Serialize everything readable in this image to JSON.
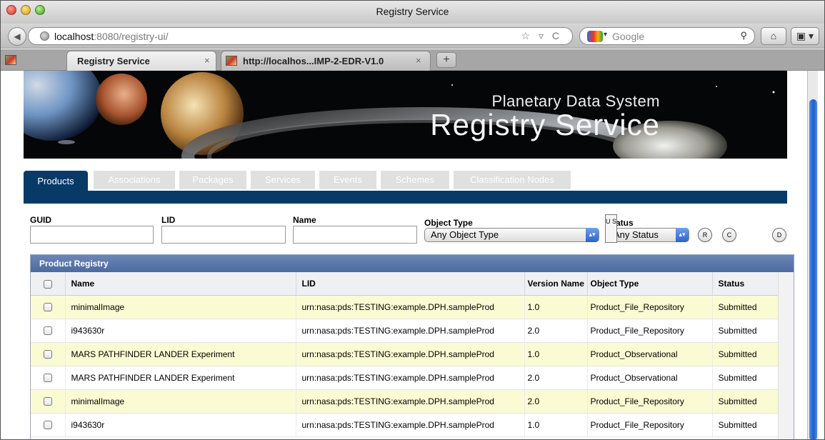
{
  "window": {
    "title": "Registry Service"
  },
  "navbar": {
    "back_icon": "back-arrow-icon",
    "url_host": "localhost",
    "url_rest": ":8080/registry-ui/",
    "url_icons": "☆ ▿ C",
    "search_placeholder": "Google",
    "home_icon": "⌂",
    "bookmark_icon": "▣"
  },
  "browser_tabs": [
    {
      "label": "Registry Service",
      "close": "×"
    },
    {
      "label": "http://localhos...IMP-2-EDR-V1.0",
      "close": "×"
    }
  ],
  "browser_tab_add": "+",
  "banner": {
    "line1": "Planetary Data System",
    "line2": "Registry Service"
  },
  "app_tabs": [
    "Products",
    "Associations",
    "Packages",
    "Services",
    "Events",
    "Schemes",
    "Classification Nodes"
  ],
  "filters": {
    "guid_label": "GUID",
    "lid_label": "LID",
    "name_label": "Name",
    "object_type_label": "Object Type",
    "object_type_value": "Any Object Type",
    "status_label": "Status",
    "status_value": "Any Status",
    "btn_r": "R",
    "btn_c": "C",
    "btn_us": "U S",
    "btn_d": "D"
  },
  "grid": {
    "title": "Product Registry",
    "columns": [
      "",
      "Name",
      "LID",
      "Version Name",
      "Object Type",
      "Status"
    ],
    "rows": [
      {
        "name": "minimalImage",
        "lid": "urn:nasa:pds:TESTING:example.DPH.sampleProd",
        "version": "1.0",
        "object_type": "Product_File_Repository",
        "status": "Submitted",
        "highlight": true
      },
      {
        "name": "i943630r",
        "lid": "urn:nasa:pds:TESTING:example.DPH.sampleProd",
        "version": "2.0",
        "object_type": "Product_File_Repository",
        "status": "Submitted",
        "highlight": false
      },
      {
        "name": "MARS PATHFINDER LANDER Experiment",
        "lid": "urn:nasa:pds:TESTING:example.DPH.sampleProd",
        "version": "1.0",
        "object_type": "Product_Observational",
        "status": "Submitted",
        "highlight": true
      },
      {
        "name": "MARS PATHFINDER LANDER Experiment",
        "lid": "urn:nasa:pds:TESTING:example.DPH.sampleProd",
        "version": "2.0",
        "object_type": "Product_Observational",
        "status": "Submitted",
        "highlight": false
      },
      {
        "name": "minimalImage",
        "lid": "urn:nasa:pds:TESTING:example.DPH.sampleProd",
        "version": "2.0",
        "object_type": "Product_File_Repository",
        "status": "Submitted",
        "highlight": true
      },
      {
        "name": "i943630r",
        "lid": "urn:nasa:pds:TESTING:example.DPH.sampleProd",
        "version": "1.0",
        "object_type": "Product_File_Repository",
        "status": "Submitted",
        "highlight": false
      }
    ]
  },
  "colors": {
    "navy": "#083a68",
    "grid_header": "#4c6a9f",
    "row_highlight": "#fbfbd3",
    "tab_inactive": "#dfe1de"
  }
}
